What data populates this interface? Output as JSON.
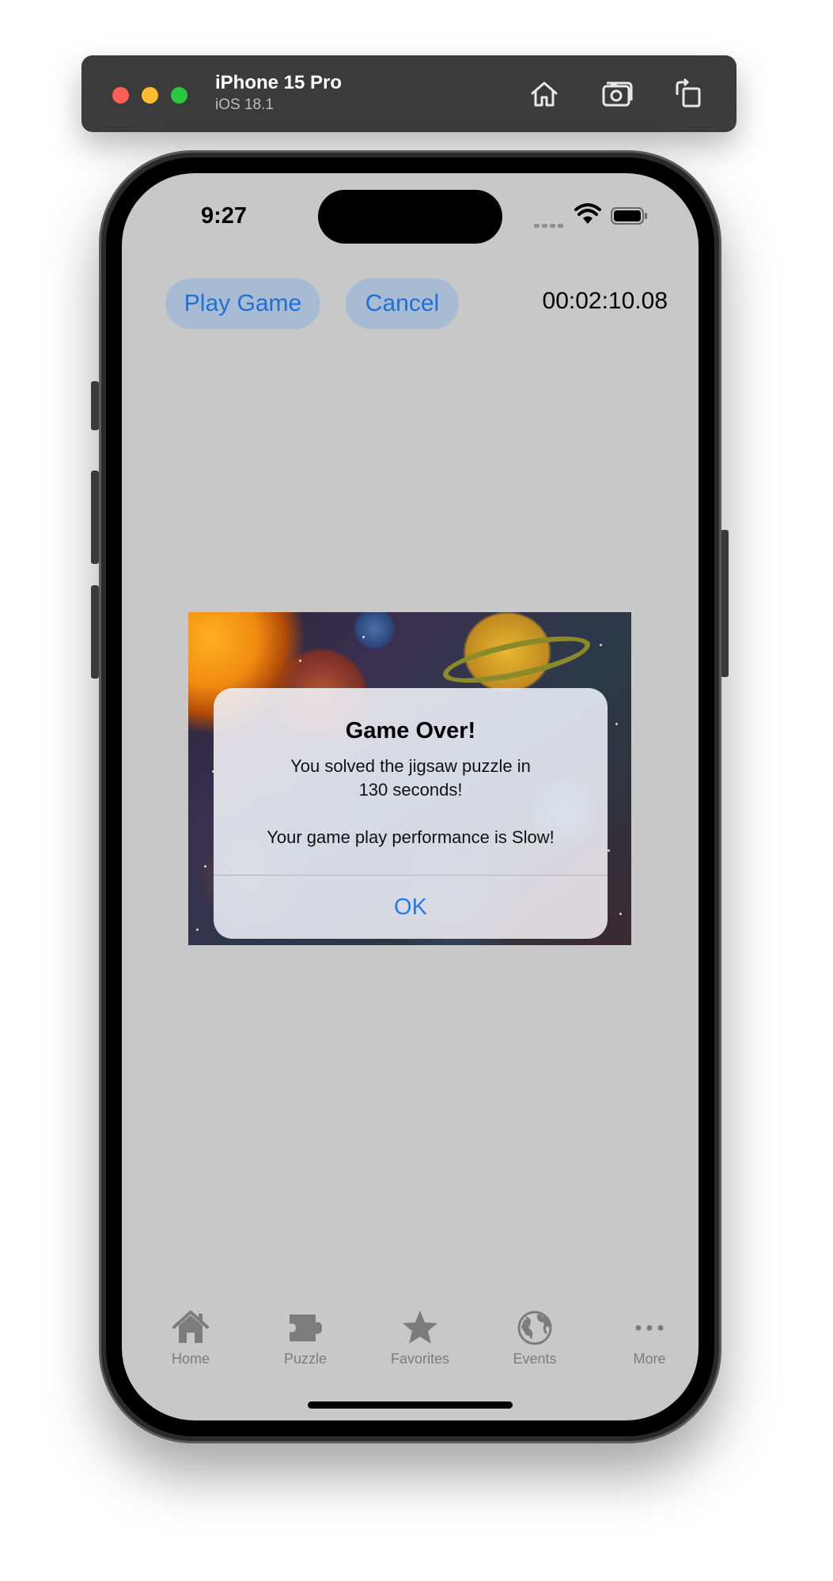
{
  "simulator": {
    "device_name": "iPhone 15 Pro",
    "os_version": "iOS 18.1",
    "toolbar_icons": [
      "home-icon",
      "screenshot-icon",
      "rotate-icon"
    ]
  },
  "status_bar": {
    "time": "9:27",
    "icons": [
      "signal-icon",
      "wifi-icon",
      "battery-icon"
    ]
  },
  "controls": {
    "play_label": "Play Game",
    "cancel_label": "Cancel",
    "timer": "00:02:10.08"
  },
  "alert": {
    "title": "Game Over!",
    "message": "You solved the jigsaw puzzle in\n130 seconds!\n\nYour game play performance is Slow!",
    "ok_label": "OK"
  },
  "tab_bar": {
    "items": [
      {
        "label": "Home",
        "icon": "home-icon"
      },
      {
        "label": "Puzzle",
        "icon": "puzzle-icon"
      },
      {
        "label": "Favorites",
        "icon": "star-icon"
      },
      {
        "label": "Events",
        "icon": "globe-icon"
      },
      {
        "label": "More",
        "icon": "more-icon"
      }
    ]
  },
  "colors": {
    "screen_background": "#c8c8c8",
    "accent": "#1f7cf0",
    "pill_background": "#a7bcd3",
    "tab_inactive": "#7c7c7c"
  }
}
